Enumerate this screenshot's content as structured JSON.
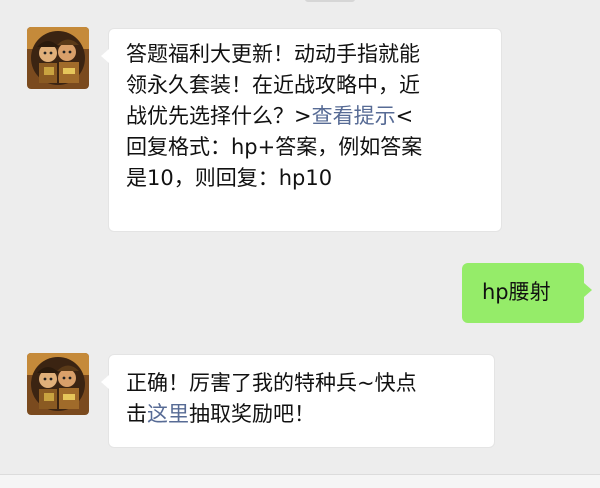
{
  "messages": [
    {
      "sender": "bot",
      "avatar_icon": "game-character-avatar",
      "parts": {
        "line1": "答题福利大更新！动动手指就能",
        "line2": "领永久套装！在近战攻略中，近",
        "line3_prefix": "战优先选择什么？>",
        "line3_link": "查看提示",
        "line3_suffix": "<",
        "line4": "回复格式：hp+答案，例如答案",
        "line5": "是10，则回复：hp10"
      }
    },
    {
      "sender": "user",
      "text": "hp腰射"
    },
    {
      "sender": "bot",
      "avatar_icon": "game-character-avatar",
      "parts": {
        "line1": "正确！厉害了我的特种兵~快点",
        "line2_prefix": "击",
        "line2_link": "这里",
        "line2_suffix": "抽取奖励吧！"
      }
    }
  ],
  "colors": {
    "background": "#ededed",
    "bubble_incoming": "#ffffff",
    "bubble_outgoing": "#95ec69",
    "link": "#576b95"
  }
}
